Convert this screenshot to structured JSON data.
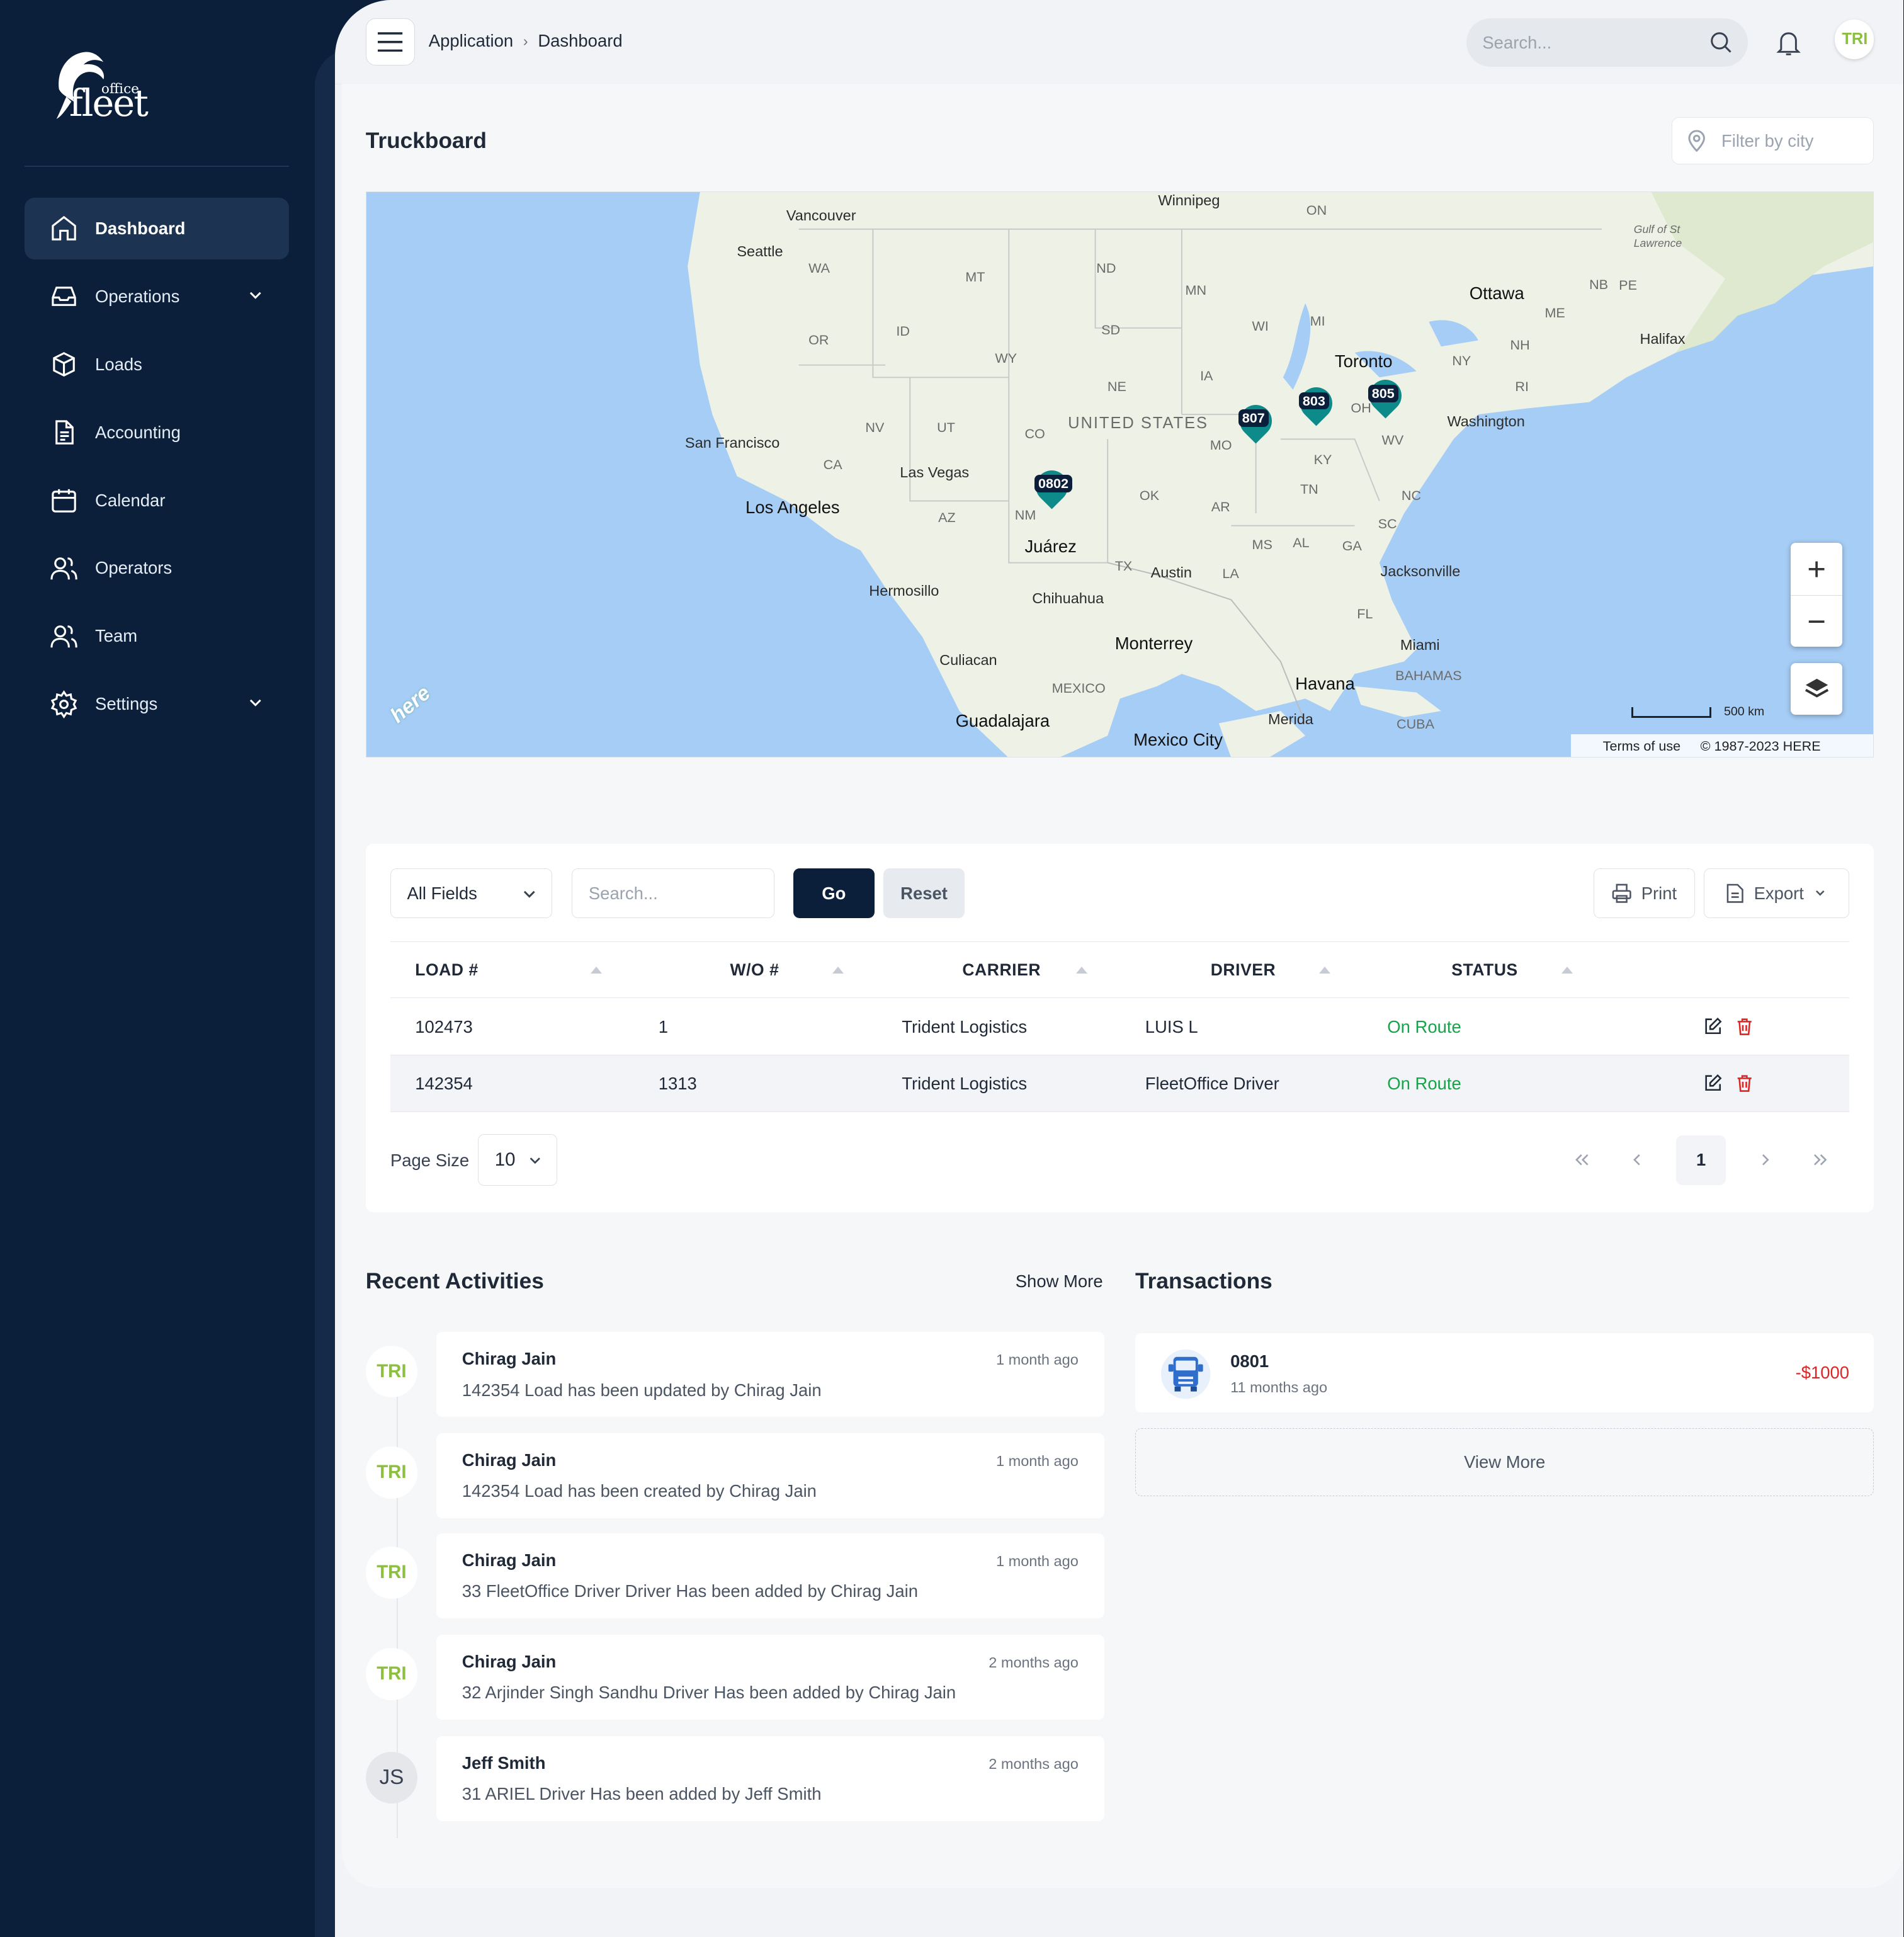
{
  "brand": {
    "logo_main": "fleet",
    "logo_sub": "office"
  },
  "sidebar": {
    "items": [
      {
        "label": "Dashboard",
        "icon": "home-icon",
        "active": true
      },
      {
        "label": "Operations",
        "icon": "inbox-icon",
        "has_submenu": true
      },
      {
        "label": "Loads",
        "icon": "box-icon"
      },
      {
        "label": "Accounting",
        "icon": "document-icon"
      },
      {
        "label": "Calendar",
        "icon": "calendar-icon"
      },
      {
        "label": "Operators",
        "icon": "users-icon"
      },
      {
        "label": "Team",
        "icon": "users-icon"
      },
      {
        "label": "Settings",
        "icon": "gear-icon",
        "has_submenu": true
      }
    ]
  },
  "header": {
    "breadcrumb": [
      "Application",
      "Dashboard"
    ],
    "search_placeholder": "Search...",
    "avatar_text": "TRI"
  },
  "truckboard": {
    "title": "Truckboard",
    "city_filter_placeholder": "Filter by city",
    "map": {
      "cities": [
        "Vancouver",
        "Seattle",
        "Winnipeg",
        "Ottawa",
        "Toronto",
        "Halifax",
        "Washington",
        "San Francisco",
        "Las Vegas",
        "Los Angeles",
        "Juárez",
        "Austin",
        "Jacksonville",
        "Hermosillo",
        "Chihuahua",
        "Monterrey",
        "Culiacan",
        "Miami",
        "Havana",
        "Guadalajara",
        "Merida",
        "Mexico City"
      ],
      "regions": [
        "ON",
        "WA",
        "MT",
        "ND",
        "MN",
        "OR",
        "ID",
        "SD",
        "WI",
        "MI",
        "ME",
        "NB",
        "PE",
        "NH",
        "WY",
        "IA",
        "NY",
        "NE",
        "RI",
        "NV",
        "UT",
        "CO",
        "OH",
        "MO",
        "WV",
        "CA",
        "KY",
        "OK",
        "AZ",
        "NM",
        "AR",
        "TN",
        "NC",
        "SC",
        "MS",
        "AL",
        "GA",
        "TX",
        "LA",
        "FL",
        "MEXICO",
        "BAHAMAS",
        "CUBA",
        "Gulf of St Lawrence"
      ],
      "country_label": "UNITED STATES",
      "markers": [
        "807",
        "803",
        "805",
        "0802"
      ],
      "scale": "500 km",
      "terms": "Terms of use",
      "copyright": "© 1987-2023 HERE",
      "watermark": "here",
      "colors": {
        "water": "#a6cdf5",
        "land": "#eef2e6",
        "marker": "#0d8a8a"
      }
    }
  },
  "loads_table": {
    "field_select": "All Fields",
    "search_placeholder": "Search...",
    "go_label": "Go",
    "reset_label": "Reset",
    "print_label": "Print",
    "export_label": "Export",
    "columns": [
      "LOAD #",
      "W/O #",
      "CARRIER",
      "DRIVER",
      "STATUS"
    ],
    "rows": [
      {
        "load": "102473",
        "wo": "1",
        "carrier": "Trident Logistics",
        "driver": "LUIS L",
        "status": "On Route"
      },
      {
        "load": "142354",
        "wo": "1313",
        "carrier": "Trident Logistics",
        "driver": "FleetOffice Driver",
        "status": "On Route"
      }
    ],
    "page_size_label": "Page Size",
    "page_size": "10",
    "current_page": "1",
    "status_color": "#16a34a"
  },
  "activities": {
    "title": "Recent Activities",
    "show_more": "Show More",
    "items": [
      {
        "avatar": "TRI",
        "name": "Chirag Jain",
        "time": "1 month ago",
        "message": "142354 Load has been updated by Chirag Jain"
      },
      {
        "avatar": "TRI",
        "name": "Chirag Jain",
        "time": "1 month ago",
        "message": "142354 Load has been created by Chirag Jain"
      },
      {
        "avatar": "TRI",
        "name": "Chirag Jain",
        "time": "1 month ago",
        "message": "33 FleetOffice Driver Driver Has been added by Chirag Jain"
      },
      {
        "avatar": "TRI",
        "name": "Chirag Jain",
        "time": "2 months ago",
        "message": "32 Arjinder Singh Sandhu Driver Has been added by Chirag Jain"
      },
      {
        "avatar": "JS",
        "name": "Jeff Smith",
        "time": "2 months ago",
        "message": "31 ARIEL Driver Has been added by Jeff Smith"
      }
    ]
  },
  "transactions": {
    "title": "Transactions",
    "items": [
      {
        "id": "0801",
        "time": "11 months ago",
        "amount": "-$1000",
        "icon": "truck-icon"
      }
    ],
    "view_more": "View More",
    "amount_color": "#dc2626"
  },
  "theme": {
    "sidebar_bg": "#0b1f3a",
    "primary_button": "#0b1f3a",
    "avatar_brand": "#8cbf3f"
  }
}
